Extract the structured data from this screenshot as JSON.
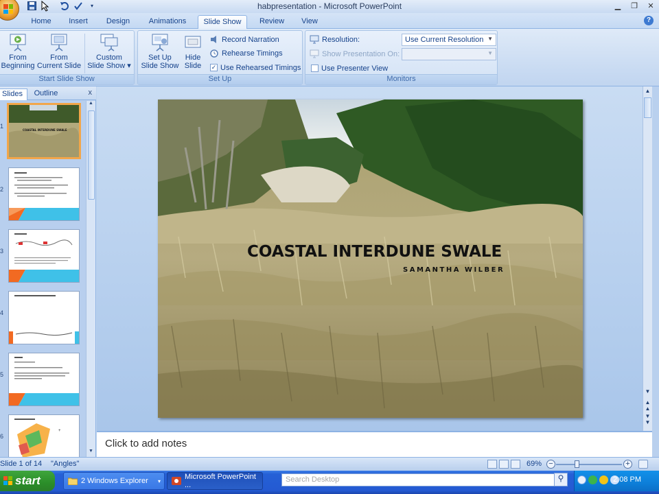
{
  "window": {
    "title": "habpresentation - Microsoft PowerPoint"
  },
  "tabs": [
    "Home",
    "Insert",
    "Design",
    "Animations",
    "Slide Show",
    "Review",
    "View"
  ],
  "active_tab": "Slide Show",
  "ribbon": {
    "start_group": {
      "label": "Start Slide Show",
      "from_beginning": [
        "From",
        "Beginning"
      ],
      "from_current": [
        "From",
        "Current Slide"
      ],
      "custom": [
        "Custom",
        "Slide Show"
      ]
    },
    "setup_group": {
      "label": "Set Up",
      "setup_show": [
        "Set Up",
        "Slide Show"
      ],
      "hide_slide": [
        "Hide",
        "Slide"
      ],
      "record_narration": "Record Narration",
      "rehearse_timings": "Rehearse Timings",
      "use_rehearsed": "Use Rehearsed Timings",
      "use_rehearsed_checked": true
    },
    "monitors_group": {
      "label": "Monitors",
      "resolution_label": "Resolution:",
      "resolution_value": "Use Current Resolution",
      "show_on_label": "Show Presentation On:",
      "show_on_value": "",
      "presenter_view": "Use Presenter View",
      "presenter_view_checked": false
    }
  },
  "slides_pane": {
    "tab_slides": "Slides",
    "tab_outline": "Outline",
    "close_glyph": "x",
    "thumbnail_numbers": [
      "1",
      "2",
      "3",
      "4",
      "5",
      "6"
    ],
    "thumb1_title": "COASTAL INTERDUNE SWALE"
  },
  "slide": {
    "title": "COASTAL INTERDUNE SWALE",
    "subtitle": "SAMANTHA WILBER"
  },
  "notes": {
    "placeholder": "Click to add notes"
  },
  "statusbar": {
    "slide_info": "Slide 1 of 14",
    "theme": "\"Angles\"",
    "zoom": "69%",
    "zoom_fraction": 0.31
  },
  "taskbar": {
    "start": "start",
    "task1": "2 Windows Explorer",
    "task2": "Microsoft PowerPoint ...",
    "search_placeholder": "Search Desktop",
    "clock": "2:08 PM"
  },
  "colors": {
    "accent_orange": "#f26a22",
    "accent_cyan": "#3fc1e8",
    "ribbon_text": "#15428b"
  }
}
